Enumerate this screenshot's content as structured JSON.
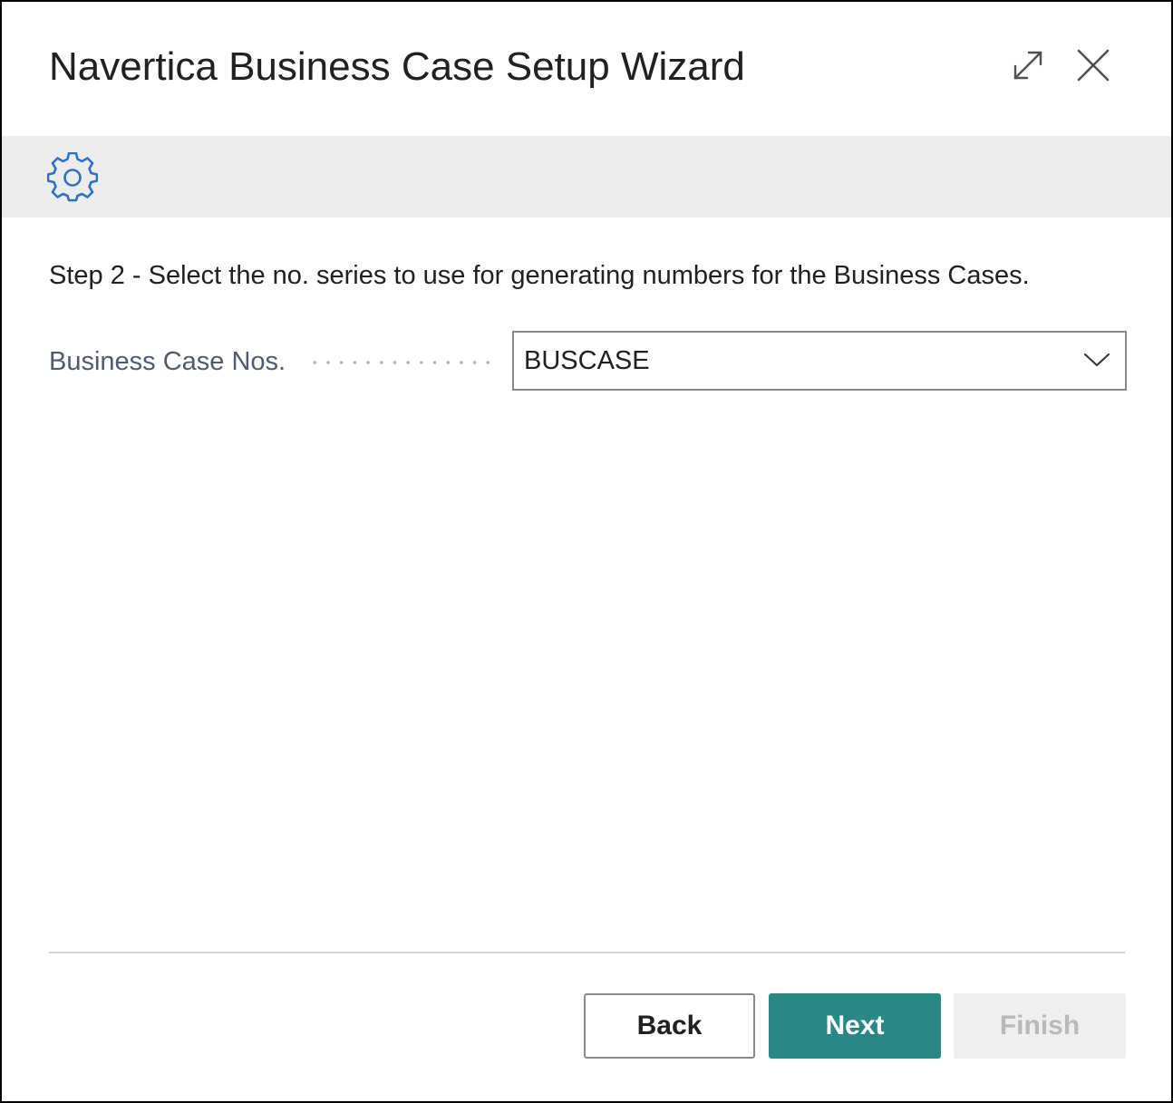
{
  "window": {
    "title": "Navertica Business Case Setup Wizard",
    "expand_icon": "expand-icon",
    "close_icon": "close-icon"
  },
  "banner": {
    "icon": "gear-icon",
    "icon_color": "#2f70c1",
    "background": "#ececec"
  },
  "content": {
    "step_text": "Step 2 - Select the no. series to use for generating numbers for the Business Cases.",
    "fields": [
      {
        "label": "Business Case Nos.",
        "value": "BUSCASE",
        "icon": "chevron-down-icon"
      }
    ]
  },
  "footer": {
    "buttons": {
      "back": "Back",
      "next": "Next",
      "finish": "Finish"
    },
    "accent_color": "#2b8786"
  }
}
